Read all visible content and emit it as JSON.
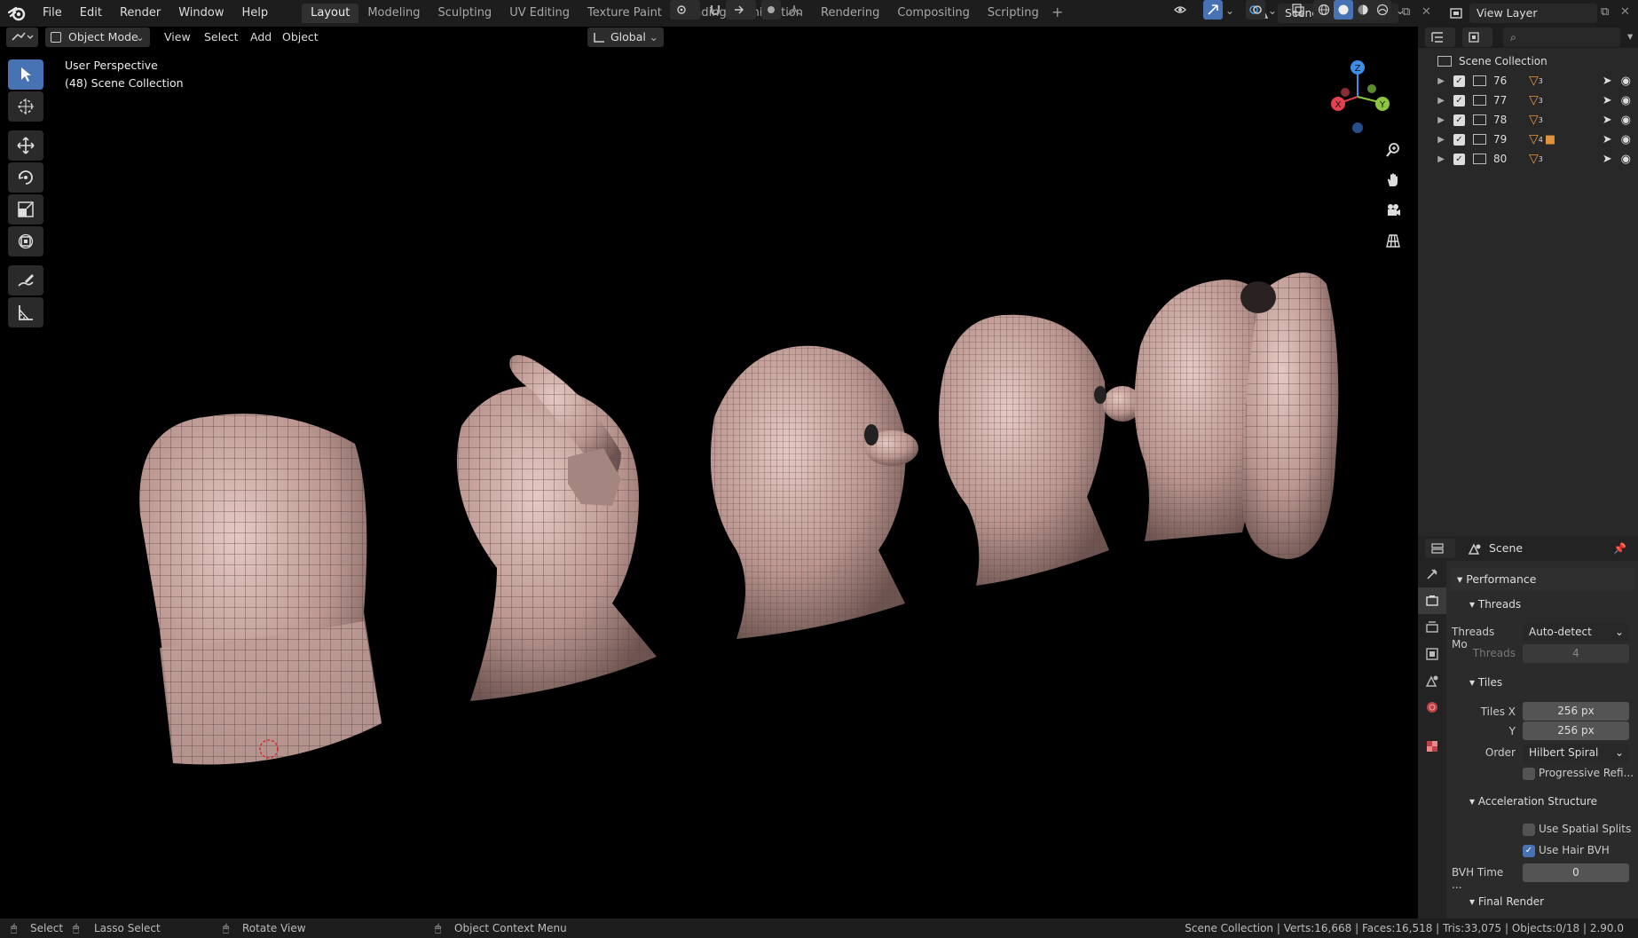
{
  "topbar": {
    "menus": [
      "File",
      "Edit",
      "Render",
      "Window",
      "Help"
    ],
    "workspaces": [
      "Layout",
      "Modeling",
      "Sculpting",
      "UV Editing",
      "Texture Paint",
      "Shading",
      "Animation",
      "Rendering",
      "Compositing",
      "Scripting"
    ],
    "active_workspace": "Layout",
    "scene_name": "Scene",
    "view_layer": "View Layer"
  },
  "viewport_header": {
    "mode": "Object Mode",
    "menus": [
      "View",
      "Select",
      "Add",
      "Object"
    ],
    "transform_orientation": "Global"
  },
  "viewport": {
    "perspective": "User Perspective",
    "collection": "(48) Scene Collection",
    "gizmo_axes": [
      "X",
      "Y",
      "Z"
    ]
  },
  "outliner": {
    "root": "Scene Collection",
    "collections": [
      {
        "name": "76",
        "mesh_count": "3"
      },
      {
        "name": "77",
        "mesh_count": "3"
      },
      {
        "name": "78",
        "mesh_count": "3"
      },
      {
        "name": "79",
        "mesh_count": "4"
      },
      {
        "name": "80",
        "mesh_count": "3"
      }
    ]
  },
  "properties": {
    "context": "Scene",
    "performance": "Performance",
    "threads_section": "Threads",
    "threads_mode_label": "Threads Mo",
    "threads_mode_value": "Auto-detect",
    "threads_label": "Threads",
    "threads_value": "4",
    "tiles_section": "Tiles",
    "tiles_x_label": "Tiles X",
    "tiles_x_value": "256 px",
    "tiles_y_label": "Y",
    "tiles_y_value": "256 px",
    "order_label": "Order",
    "order_value": "Hilbert Spiral",
    "progressive_label": "Progressive Refi...",
    "progressive_checked": false,
    "accel_section": "Acceleration Structure",
    "spatial_splits_label": "Use Spatial Splits",
    "spatial_splits_checked": false,
    "hair_bvh_label": "Use Hair BVH",
    "hair_bvh_checked": true,
    "bvh_time_label": "BVH Time ...",
    "bvh_time_value": "0",
    "final_render_section": "Final Render"
  },
  "statusbar": {
    "select": "Select",
    "lasso": "Lasso Select",
    "rotate": "Rotate View",
    "context_menu": "Object Context Menu",
    "stats": "Scene Collection | Verts:16,668 | Faces:16,518 | Tris:33,075 | Objects:0/18 | 2.90.0"
  },
  "colors": {
    "accent": "#4772b3",
    "mesh": "#c9a7a2",
    "axis_x": "#e5404f",
    "axis_y": "#8cc63f",
    "axis_z": "#3c8ee8"
  }
}
